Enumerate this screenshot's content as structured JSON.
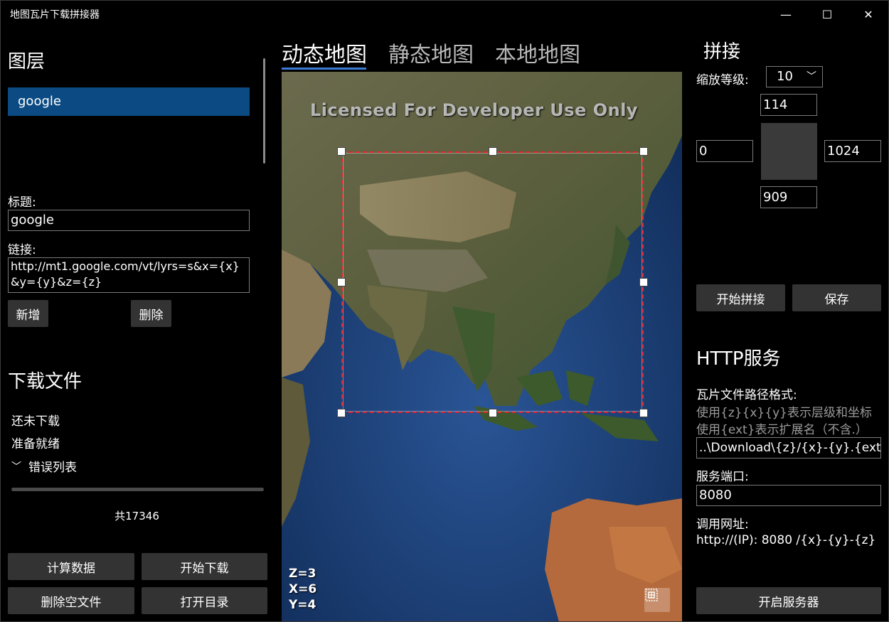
{
  "window": {
    "title": "地图瓦片下载拼接器",
    "minimize_glyph": "—",
    "maximize_glyph": "☐",
    "close_glyph": "✕"
  },
  "layers": {
    "heading": "图层",
    "items": [
      "google"
    ]
  },
  "layer_form": {
    "title_label": "标题:",
    "title_value": "google",
    "link_label": "链接:",
    "link_value": "http://mt1.google.com/vt/lyrs=s&x={x}&y={y}&z={z}",
    "add_label": "新增",
    "delete_label": "删除"
  },
  "download": {
    "heading": "下载文件",
    "status_1": "还未下载",
    "status_2": "准备就绪",
    "error_list_label": "错误列表",
    "progress": 0,
    "total_text": "共17346",
    "compute_label": "计算数据",
    "start_label": "开始下载",
    "delete_empty_label": "删除空文件",
    "open_dir_label": "打开目录"
  },
  "tabs": [
    {
      "label": "动态地图",
      "active": true
    },
    {
      "label": "静态地图",
      "active": false
    },
    {
      "label": "本地地图",
      "active": false
    }
  ],
  "map": {
    "watermark": "Licensed For Developer Use Only",
    "z_text": "Z=3",
    "x_text": "X=6",
    "y_text": "Y=4",
    "layers_icon": "layers-icon",
    "colors": {
      "selection_border": "#e8202a",
      "ocean": "#1b3f78"
    }
  },
  "stitch": {
    "heading": "拼接",
    "zoom_label": "缩放等级:",
    "zoom_value": "10",
    "top_value": "114",
    "left_value": "0",
    "right_value": "1024",
    "bottom_value": "909",
    "start_label": "开始拼接",
    "save_label": "保存"
  },
  "http": {
    "heading": "HTTP服务",
    "path_label": "瓦片文件路径格式:",
    "hint_1": "使用{z}{x}{y}表示层级和坐标",
    "hint_2": "使用{ext}表示扩展名（不含.）",
    "path_value": "..\\Download\\{z}/{x}-{y}.{ext}",
    "port_label": "服务端口:",
    "port_value": "8080",
    "url_label": "调用网址:",
    "url_value": "http://(IP): 8080 /{x}-{y}-{z}",
    "start_server_label": "开启服务器"
  }
}
